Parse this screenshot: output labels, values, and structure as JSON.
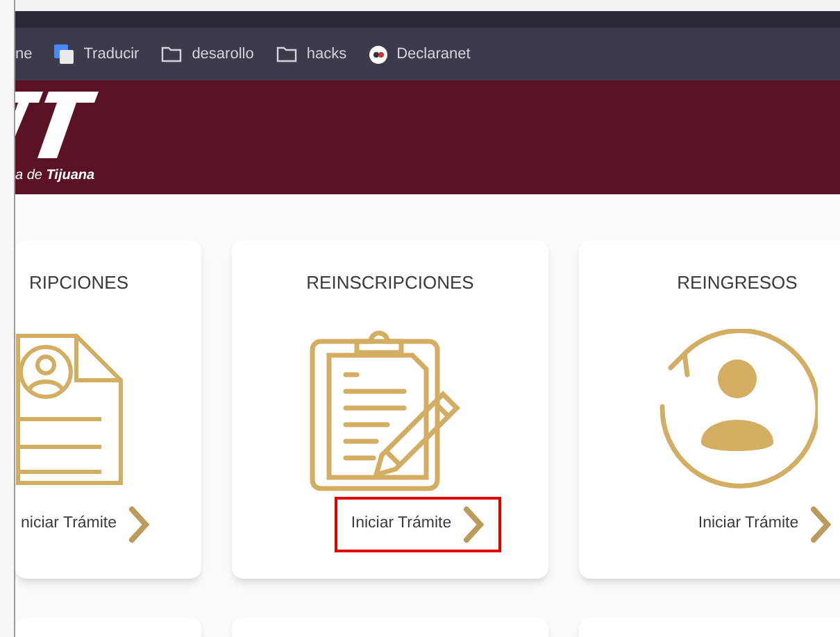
{
  "bookmarks": [
    {
      "kind": "plain",
      "label": "ne"
    },
    {
      "kind": "translate",
      "label": "Traducir"
    },
    {
      "kind": "folder",
      "label": "desarollo"
    },
    {
      "kind": "folder",
      "label": "hacks"
    },
    {
      "kind": "site",
      "label": "Declaranet"
    }
  ],
  "header": {
    "logo_text": "a de **Tijuana**"
  },
  "cards": [
    {
      "title": "RIPCIONES",
      "kind": "document",
      "button": "niciar Trámite",
      "highlighted": false
    },
    {
      "title": "REINSCRIPCIONES",
      "kind": "clipboard",
      "button": "Iniciar Trámite",
      "highlighted": true
    },
    {
      "title": "REINGRESOS",
      "kind": "return",
      "button": "Iniciar Trámite",
      "highlighted": false
    }
  ]
}
